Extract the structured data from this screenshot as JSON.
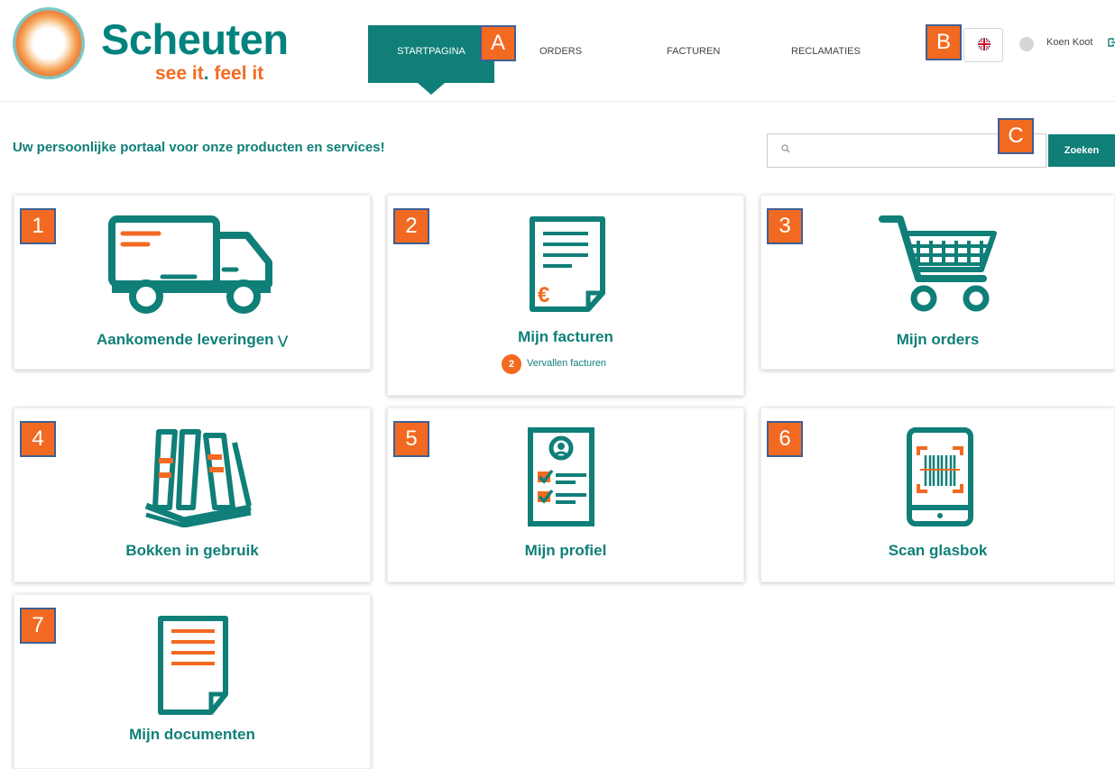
{
  "logo": {
    "name": "Scheuten",
    "tagline_part1": "see it",
    "tagline_dot": ".",
    "tagline_part2": " feel it"
  },
  "nav": {
    "startpagina": "STARTPAGINA",
    "orders": "ORDERS",
    "facturen": "FACTUREN",
    "reclamaties": "RECLAMATIES"
  },
  "header": {
    "user": "Koen Koot",
    "logout_icon": "logout-icon",
    "language": "en-flag"
  },
  "markers": {
    "a": "A",
    "b": "B",
    "c": "C",
    "t1": "1",
    "t2": "2",
    "t3": "3",
    "t4": "4",
    "t5": "5",
    "t6": "6",
    "t7": "7"
  },
  "tagline": "Uw persoonlijke portaal voor onze producten en services!",
  "search": {
    "placeholder": "",
    "button": "Zoeken"
  },
  "tiles": {
    "deliveries": {
      "label": "Aankomende leveringen",
      "icon": "truck-icon"
    },
    "invoices": {
      "label": "Mijn facturen",
      "icon": "invoice-icon",
      "badge_count": "2",
      "badge_text": "Vervallen facturen"
    },
    "orders": {
      "label": "Mijn orders",
      "icon": "cart-icon"
    },
    "racks": {
      "label": "Bokken in gebruik",
      "icon": "glass-rack-icon"
    },
    "profile": {
      "label": "Mijn profiel",
      "icon": "profile-icon"
    },
    "scan": {
      "label": "Scan glasbok",
      "icon": "barcode-scan-icon"
    },
    "documents": {
      "label": "Mijn documenten",
      "icon": "document-icon"
    }
  },
  "colors": {
    "brand": "#0f7f78",
    "accent": "#f26a21",
    "marker_border": "#3f5f94"
  }
}
